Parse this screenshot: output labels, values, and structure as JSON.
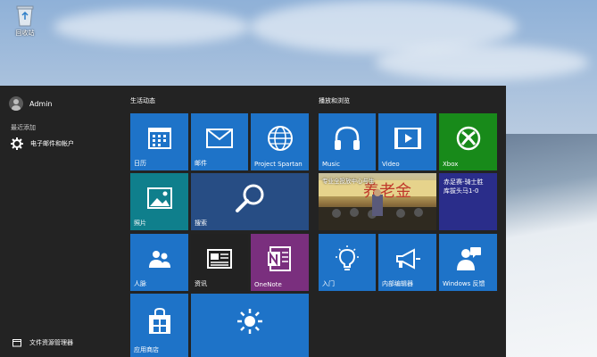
{
  "desktop": {
    "recycle_bin_label": "回收站"
  },
  "start": {
    "user_name": "Admin",
    "recent_label": "最近添加",
    "recent_items": [
      {
        "label": "电子邮件和帐户",
        "icon": "gear-icon"
      }
    ],
    "file_explorer_label": "文件资源管理器"
  },
  "groups": {
    "life_title": "生活动态",
    "play_title": "播放和浏览"
  },
  "tiles": {
    "calendar": "日历",
    "mail": "邮件",
    "spartan": "Project Spartan",
    "photos": "照片",
    "search": "搜索",
    "people": "人脉",
    "news": "资讯",
    "onenote": "OneNote",
    "store": "应用商店",
    "music": "Music",
    "video": "Video",
    "xbox": "Xbox",
    "news_caption": "专业全投放中心与生",
    "sport": "赤足赛-骑士胜\n库拔头马1-0",
    "getstarted": "入门",
    "insider": "内部编辑器",
    "feedback": "Windows 反馈"
  },
  "colors": {
    "accent": "#1e73c8",
    "start_bg": "#232323",
    "xbox": "#188a1a",
    "onenote": "#7a2f7e"
  }
}
